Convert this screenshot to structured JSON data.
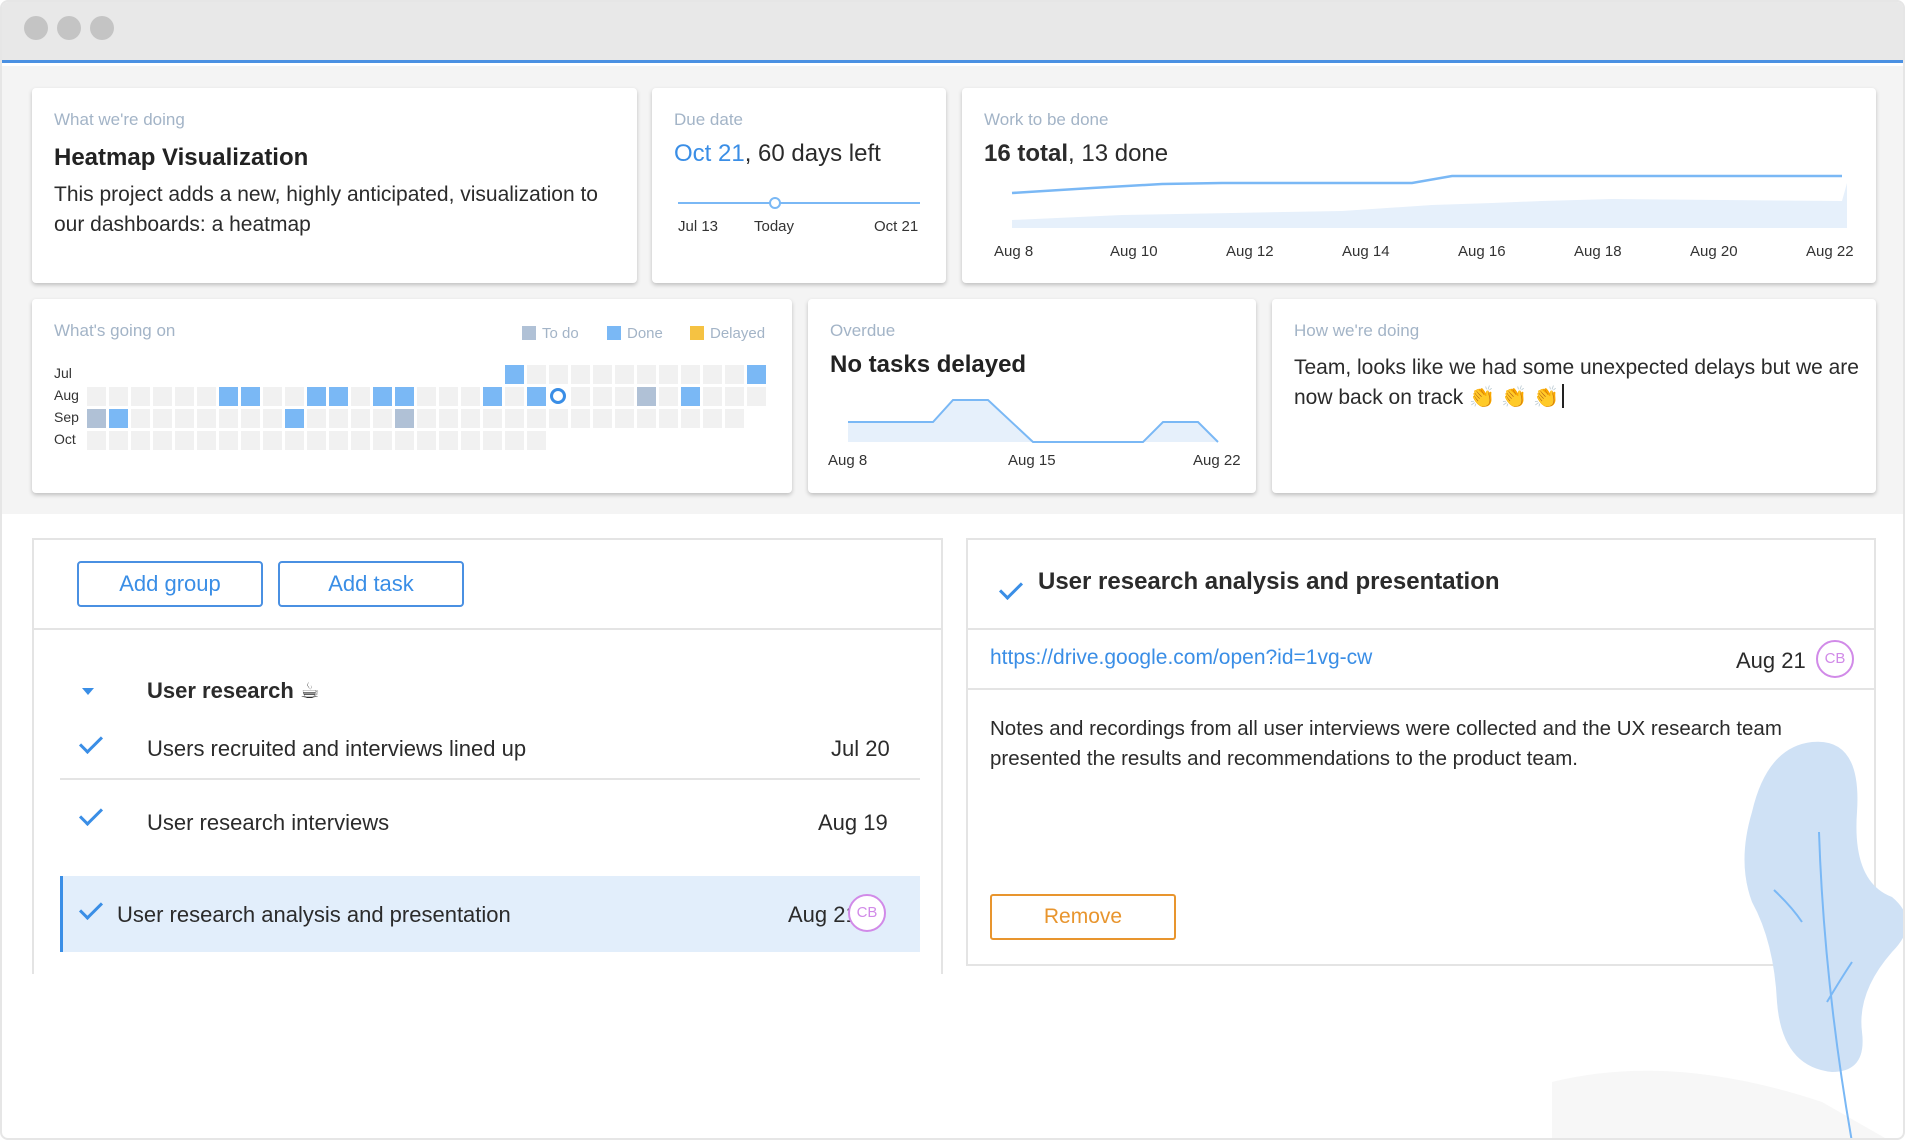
{
  "colors": {
    "accent": "#3a8ee6",
    "todo": "#b0c1d6",
    "done": "#7ab8f5",
    "delayed": "#f5c242",
    "avatar": "#d18ae8",
    "remove": "#e8952e"
  },
  "project": {
    "label": "What we're doing",
    "title": "Heatmap Visualization",
    "description": "This project adds a new, highly anticipated, visualization to our dashboards: a heatmap"
  },
  "due": {
    "label": "Due date",
    "date": "Oct 21",
    "rest": ", 60 days left",
    "start": "Jul 13",
    "today": "Today",
    "end": "Oct 21"
  },
  "work": {
    "label": "Work to be done",
    "total": "16 total",
    "rest": ", 13 done",
    "ticks": [
      "Aug 8",
      "Aug 10",
      "Aug 12",
      "Aug 14",
      "Aug 16",
      "Aug 18",
      "Aug 20",
      "Aug 22"
    ]
  },
  "activity": {
    "label": "What's going on",
    "legend": [
      "To do",
      "Done",
      "Delayed"
    ],
    "rows": [
      "Jul",
      "Aug",
      "Sep",
      "Oct"
    ]
  },
  "overdue": {
    "label": "Overdue",
    "title": "No tasks delayed",
    "ticks": [
      "Aug 8",
      "Aug 15",
      "Aug 22"
    ]
  },
  "status": {
    "label": "How we're doing",
    "text": "Team, looks like we had some unexpected delays but we are now back on track 👏 👏 👏"
  },
  "toolbar": {
    "add_group": "Add group",
    "add_task": "Add task"
  },
  "group": {
    "name": "User research ☕"
  },
  "tasks": [
    {
      "name": "Users recruited and interviews lined up",
      "date": "Jul 20"
    },
    {
      "name": "User research interviews",
      "date": "Aug 19"
    },
    {
      "name": "User research analysis and presentation",
      "date": "Aug 21",
      "assignee": "CB"
    }
  ],
  "detail": {
    "title": "User research analysis and presentation",
    "link": "https://drive.google.com/open?id=1vg-cw",
    "date": "Aug 21",
    "assignee": "CB",
    "notes": "Notes and recordings from all user interviews were collected and the UX research team presented the results and recommendations to the product team.",
    "remove": "Remove"
  }
}
